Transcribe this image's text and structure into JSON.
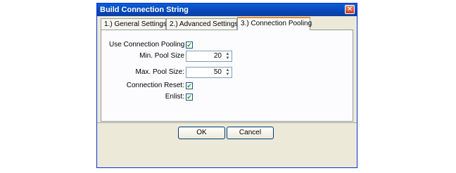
{
  "window": {
    "title": "Build Connection String",
    "close_glyph": "✕"
  },
  "tabs": [
    {
      "label": "1.) General Settings"
    },
    {
      "label": "2.) Advanced Settings"
    },
    {
      "label": "3.) Connection Pooling",
      "active": true
    }
  ],
  "pooling": {
    "use_pooling_label": "Use Connection Pooling",
    "use_pooling_checked": true,
    "min_pool_label": "Min. Pool Size",
    "min_pool_value": "20",
    "max_pool_label": "Max. Pool Size:",
    "max_pool_value": "50",
    "connection_reset_label": "Connection Reset:",
    "connection_reset_checked": true,
    "enlist_label": "Enlist:",
    "enlist_checked": true,
    "check_glyph": "✔"
  },
  "spinner": {
    "up_glyph": "▲",
    "down_glyph": "▼"
  },
  "buttons": {
    "ok_label": "OK",
    "cancel_label": "Cancel"
  },
  "colors": {
    "title_bar": "#0a5fd8",
    "dialog_bg": "#ece9d8",
    "panel_bg": "#fcfcfe",
    "active_tab_accent": "#e68b2c",
    "check": "#21a121"
  }
}
